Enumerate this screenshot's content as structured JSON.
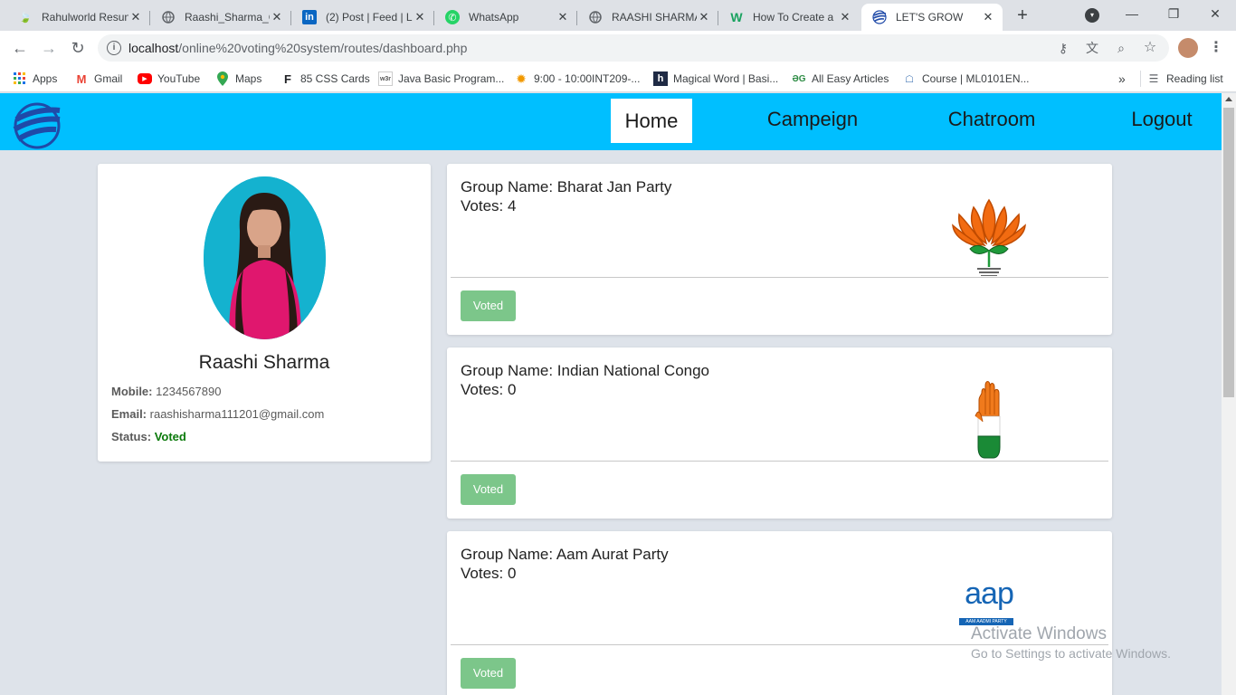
{
  "browser": {
    "tabs": [
      {
        "title": "Rahulworld Resun",
        "icon": "leaf-icon"
      },
      {
        "title": "Raashi_Sharma_C",
        "icon": "globe-icon"
      },
      {
        "title": "(2) Post | Feed | L",
        "icon": "linkedin-icon"
      },
      {
        "title": "WhatsApp",
        "icon": "whatsapp-icon"
      },
      {
        "title": "RAASHI SHARMA",
        "icon": "globe-icon"
      },
      {
        "title": "How To Create a",
        "icon": "w-icon"
      },
      {
        "title": "LET'S GROW",
        "icon": "site-logo-icon"
      }
    ],
    "url_host": "localhost",
    "url_path": "/online%20voting%20system/routes/dashboard.php",
    "bookmarks": [
      {
        "label": "Apps"
      },
      {
        "label": "Gmail"
      },
      {
        "label": "YouTube"
      },
      {
        "label": "Maps"
      },
      {
        "label": "85 CSS Cards"
      },
      {
        "label": "Java Basic Program..."
      },
      {
        "label": "9:00 - 10:00INT209-..."
      },
      {
        "label": "Magical Word | Basi..."
      },
      {
        "label": "All Easy Articles"
      },
      {
        "label": "Course | ML0101EN..."
      }
    ],
    "more_bookmarks": "»",
    "reading_list": "Reading list"
  },
  "nav": {
    "links": [
      "Home",
      "Campeign",
      "Chatroom",
      "Logout"
    ],
    "accent": "#00bfff"
  },
  "profile": {
    "name": "Raashi Sharma",
    "mobile_label": "Mobile:",
    "mobile": "1234567890",
    "email_label": "Email:",
    "email": "raashisharma111201@gmail.com",
    "status_label": "Status:",
    "status": "Voted"
  },
  "groups": [
    {
      "name_label": "Group Name:",
      "name": "Bharat Jan Party",
      "votes_label": "Votes:",
      "votes": "4",
      "button": "Voted",
      "symbol": "lotus-icon"
    },
    {
      "name_label": "Group Name:",
      "name": "Indian National Congo",
      "votes_label": "Votes:",
      "votes": "0",
      "button": "Voted",
      "symbol": "hand-icon"
    },
    {
      "name_label": "Group Name:",
      "name": "Aam Aurat Party",
      "votes_label": "Votes:",
      "votes": "0",
      "button": "Voted",
      "symbol": "aap-logo",
      "symbol_text": "aap",
      "symbol_subtext": "AAM AADMI PARTY"
    }
  ],
  "watermark": {
    "line1": "Activate Windows",
    "line2": "Go to Settings to activate Windows."
  }
}
